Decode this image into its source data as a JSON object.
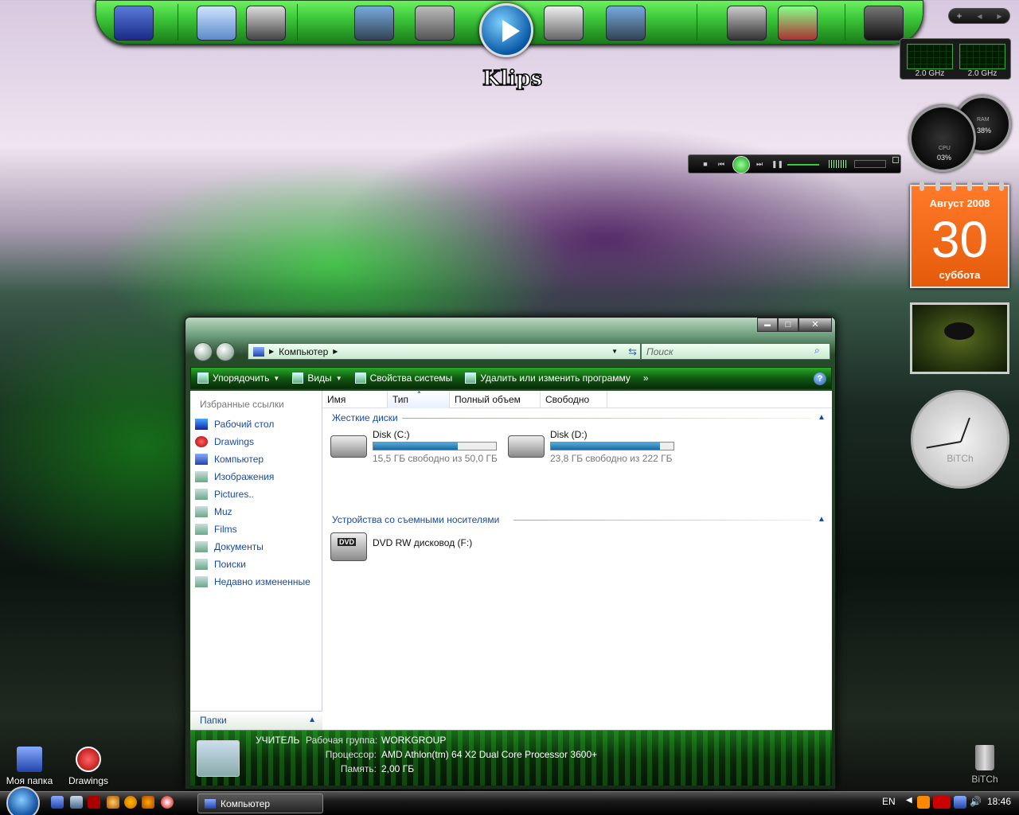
{
  "dock": {
    "items": [
      "drive-icon",
      "network-icon",
      "computer-icon",
      "film-reel-icon",
      "gear-film-icon",
      "play-icon",
      "jpeg-icon",
      "film-reel-icon",
      "hard-disk-icon",
      "network-drive-icon",
      "alienware-icon"
    ],
    "active_label": "Klips"
  },
  "gadget_nav": {
    "add": "+",
    "prev": "◀",
    "next": "▶"
  },
  "cpu_meter": {
    "core1": "2.0 GHz",
    "core2": "2.0 GHz"
  },
  "gauges": {
    "cpu": "03%",
    "ram": "38%",
    "cpu_label": "CPU",
    "ram_label": "RAM"
  },
  "calendar": {
    "month_year": "Август 2008",
    "day": "30",
    "weekday": "суббота"
  },
  "clock": {
    "label": "BiTCh"
  },
  "window": {
    "title_buttons": {
      "minimize": "▬",
      "maximize": "□",
      "close": "✕"
    },
    "address": {
      "root": "Компьютер"
    },
    "search_placeholder": "Поиск",
    "toolbar": {
      "organize": "Упорядочить",
      "views": "Виды",
      "system_props": "Свойства системы",
      "uninstall": "Удалить или изменить программу",
      "more": "»",
      "help": "?"
    },
    "nav_pane": {
      "title": "Избранные ссылки",
      "items": [
        "Рабочий стол",
        "Drawings",
        "Компьютер",
        "Изображения",
        "Pictures..",
        "Muz",
        "Films",
        "Документы",
        "Поиски",
        "Недавно измененные"
      ],
      "folders": "Папки"
    },
    "columns": [
      "Имя",
      "Тип",
      "Полный объем",
      "Свободно"
    ],
    "groups": {
      "hard_disks": "Жесткие диски",
      "removable": "Устройства со съемными носителями"
    },
    "drives": [
      {
        "name": "Disk (C:)",
        "free": "15,5 ГБ свободно из 50,0 ГБ",
        "used_fraction": 0.69
      },
      {
        "name": "Disk (D:)",
        "free": "23,8 ГБ свободно из 222 ГБ",
        "used_fraction": 0.89
      }
    ],
    "dvd": {
      "name": "DVD RW дисковод (F:)",
      "badge": "DVD"
    },
    "details": {
      "computer": "УЧИТЕЛЬ",
      "workgroup_label": "Рабочая группа:",
      "workgroup": "WORKGROUP",
      "cpu_label": "Процессор:",
      "cpu": "AMD Athlon(tm) 64 X2 Dual Core Processor 3600+",
      "ram_label": "Память:",
      "ram": "2,00 ГБ"
    }
  },
  "desktop": {
    "icons": [
      {
        "label": "Моя папка"
      },
      {
        "label": "Drawings"
      },
      {
        "label": "BiTCh"
      }
    ]
  },
  "taskbar": {
    "task": "Компьютер",
    "lang": "EN",
    "time": "18:46"
  }
}
